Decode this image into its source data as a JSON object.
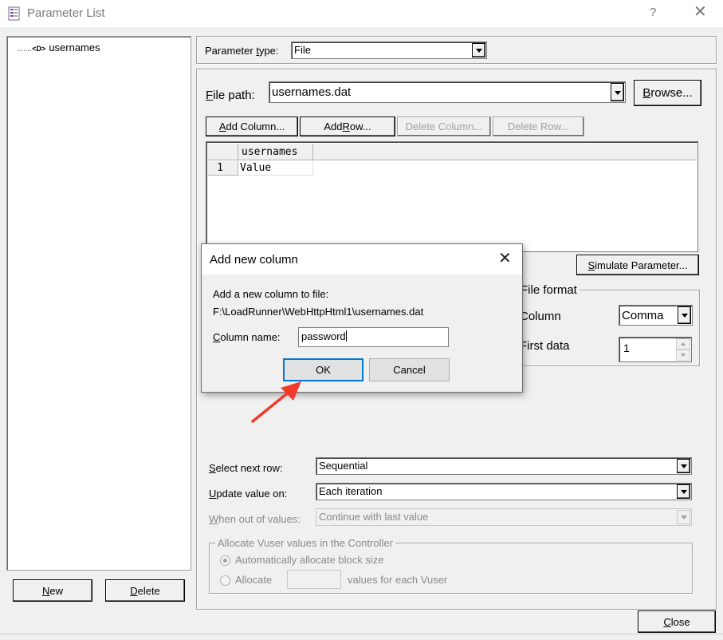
{
  "window": {
    "title": "Parameter List",
    "help_glyph": "?",
    "close_glyph": "✕"
  },
  "tree": {
    "items": [
      {
        "label": "usernames",
        "icon": "parameter-icon",
        "icon_glyph": "<D>",
        "dots": "......."
      }
    ]
  },
  "left_buttons": {
    "new_label": "New",
    "new_rest": "ew",
    "new_mnemonic": "N",
    "delete_label": "Delete",
    "delete_mnemonic": "D",
    "delete_rest": "elete"
  },
  "param_type": {
    "label_pre": "Parameter ",
    "label_mn": "t",
    "label_post": "ype:",
    "value": "File"
  },
  "file_path": {
    "label_mn": "F",
    "label_rest": "ile path:",
    "value": "usernames.dat",
    "browse_pre": "",
    "browse_mn": "B",
    "browse_post": "rowse..."
  },
  "column_buttons": {
    "add_column": {
      "mn": "A",
      "rest": "dd Column..."
    },
    "add_row": {
      "pre": "Add ",
      "mn": "R",
      "rest": "ow..."
    },
    "delete_column": "Delete Column...",
    "delete_row": "Delete Row..."
  },
  "grid": {
    "columns": [
      "usernames"
    ],
    "rows": [
      {
        "num": "1",
        "cells": [
          "Value"
        ]
      }
    ]
  },
  "simulate": {
    "mn": "S",
    "rest": "imulate Parameter..."
  },
  "file_format": {
    "title": "File format",
    "column_label": "Column",
    "column_value": "Comma",
    "first_data_label": "First data",
    "first_data_value": "1"
  },
  "select_next_row": {
    "mn": "S",
    "rest": "elect next row:",
    "value": "Sequential"
  },
  "update_value_on": {
    "mn": "U",
    "rest": "pdate value on:",
    "value": "Each iteration"
  },
  "when_out": {
    "mn": "W",
    "rest": "hen out of values:",
    "value": "Continue with last value"
  },
  "allocate_group": {
    "title": "Allocate Vuser values in the Controller",
    "auto_label": "Automatically allocate block size",
    "alloc_label": "Allocate",
    "alloc_suffix": "values for each Vuser"
  },
  "close_button": {
    "mn": "C",
    "rest": "lose"
  },
  "modal": {
    "title": "Add new column",
    "close_glyph": "✕",
    "line1": "Add a new column to file:",
    "line2": "F:\\LoadRunner\\WebHttpHtml1\\usernames.dat",
    "column_name_mn": "C",
    "column_name_rest": "olumn name:",
    "column_name_value": "password",
    "ok_label": "OK",
    "cancel_label": "Cancel"
  },
  "colors": {
    "annotation_arrow": "#f03a2e",
    "focus_border": "#0078d7"
  }
}
